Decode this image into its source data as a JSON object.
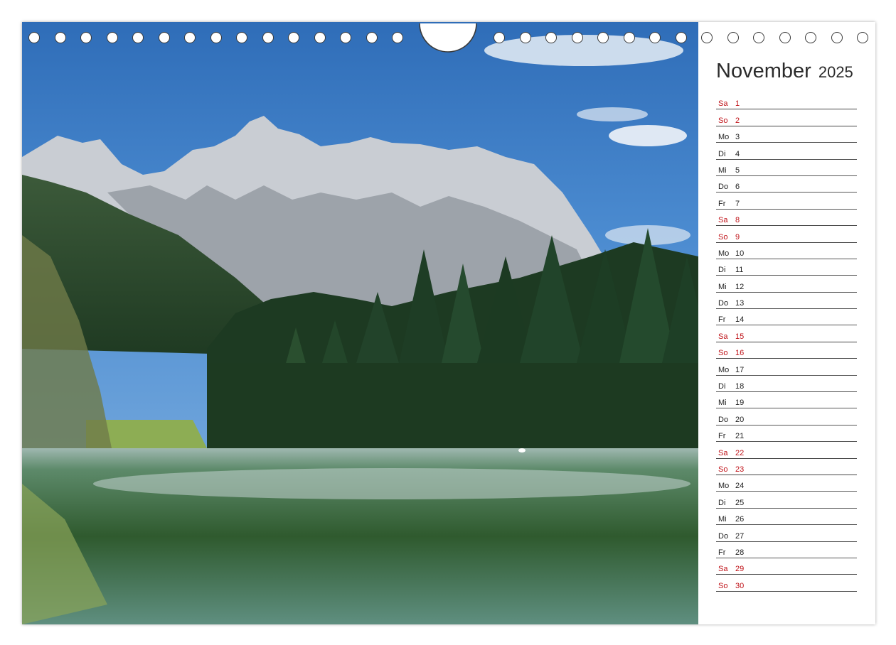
{
  "calendar": {
    "month": "November",
    "year": "2025"
  },
  "days": [
    {
      "dn": "Sa",
      "num": "1",
      "weekend": true
    },
    {
      "dn": "So",
      "num": "2",
      "weekend": true
    },
    {
      "dn": "Mo",
      "num": "3",
      "weekend": false
    },
    {
      "dn": "Di",
      "num": "4",
      "weekend": false
    },
    {
      "dn": "Mi",
      "num": "5",
      "weekend": false
    },
    {
      "dn": "Do",
      "num": "6",
      "weekend": false
    },
    {
      "dn": "Fr",
      "num": "7",
      "weekend": false
    },
    {
      "dn": "Sa",
      "num": "8",
      "weekend": true
    },
    {
      "dn": "So",
      "num": "9",
      "weekend": true
    },
    {
      "dn": "Mo",
      "num": "10",
      "weekend": false
    },
    {
      "dn": "Di",
      "num": "11",
      "weekend": false
    },
    {
      "dn": "Mi",
      "num": "12",
      "weekend": false
    },
    {
      "dn": "Do",
      "num": "13",
      "weekend": false
    },
    {
      "dn": "Fr",
      "num": "14",
      "weekend": false
    },
    {
      "dn": "Sa",
      "num": "15",
      "weekend": true
    },
    {
      "dn": "So",
      "num": "16",
      "weekend": true
    },
    {
      "dn": "Mo",
      "num": "17",
      "weekend": false
    },
    {
      "dn": "Di",
      "num": "18",
      "weekend": false
    },
    {
      "dn": "Mi",
      "num": "19",
      "weekend": false
    },
    {
      "dn": "Do",
      "num": "20",
      "weekend": false
    },
    {
      "dn": "Fr",
      "num": "21",
      "weekend": false
    },
    {
      "dn": "Sa",
      "num": "22",
      "weekend": true
    },
    {
      "dn": "So",
      "num": "23",
      "weekend": true
    },
    {
      "dn": "Mo",
      "num": "24",
      "weekend": false
    },
    {
      "dn": "Di",
      "num": "25",
      "weekend": false
    },
    {
      "dn": "Mi",
      "num": "26",
      "weekend": false
    },
    {
      "dn": "Do",
      "num": "27",
      "weekend": false
    },
    {
      "dn": "Fr",
      "num": "28",
      "weekend": false
    },
    {
      "dn": "Sa",
      "num": "29",
      "weekend": true
    },
    {
      "dn": "So",
      "num": "30",
      "weekend": true
    }
  ],
  "colors": {
    "weekend": "#c0141a",
    "weekday": "#222222",
    "sky": "#3f7fc4",
    "lake": "#3f6a3a"
  }
}
